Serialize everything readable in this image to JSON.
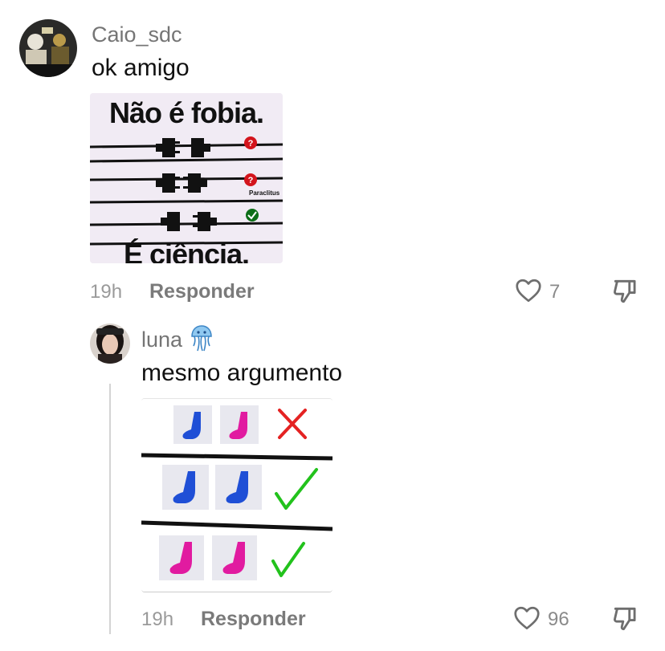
{
  "comments": [
    {
      "username": "Caio_sdc",
      "text": "ok amigo",
      "image": {
        "top_text": "Não é fobia.",
        "bottom_text": "É ciência.",
        "watermark": "Paraclitus",
        "rows": [
          {
            "status": "question"
          },
          {
            "status": "question"
          },
          {
            "status": "check"
          }
        ]
      },
      "time": "19h",
      "reply_label": "Responder",
      "likes": "7"
    },
    {
      "username": "luna",
      "badge_icon": "jellyfish-emoji",
      "text": "mesmo argumento",
      "image": {
        "rows": [
          {
            "socks": [
              "blue",
              "pink"
            ],
            "status": "cross"
          },
          {
            "socks": [
              "blue",
              "blue"
            ],
            "status": "check"
          },
          {
            "socks": [
              "pink",
              "pink"
            ],
            "status": "check"
          }
        ]
      },
      "time": "19h",
      "reply_label": "Responder",
      "likes": "96"
    }
  ],
  "colors": {
    "sock_blue": "#1f4fd6",
    "sock_pink": "#e11ba0",
    "check_green": "#22c21c",
    "cross_red": "#e42222",
    "question_red": "#d3141c"
  }
}
